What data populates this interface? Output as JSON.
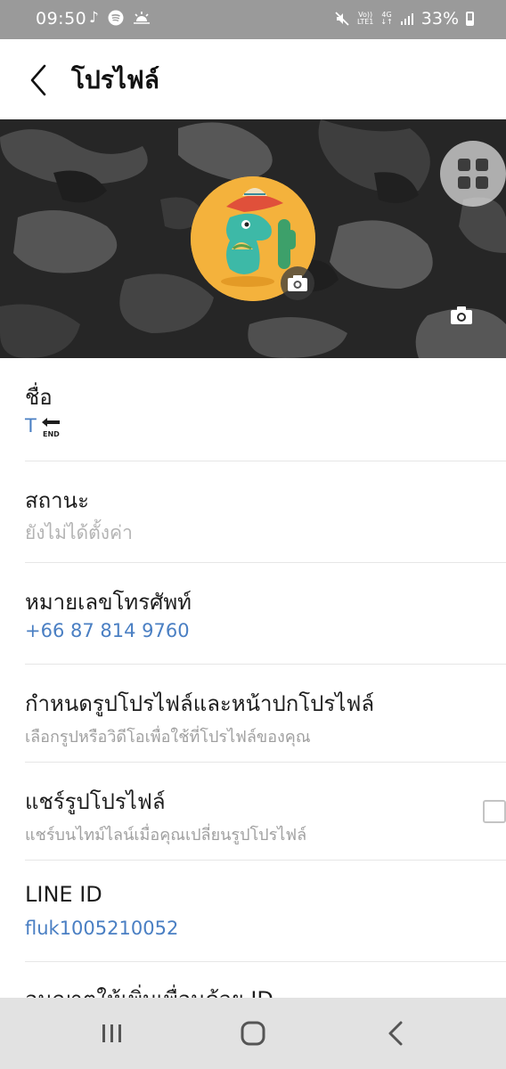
{
  "status_bar": {
    "time": "09:50",
    "left_icons": [
      "music-note-icon",
      "spotify-icon",
      "weather-sunrise-icon"
    ],
    "right_icons": [
      "mute-icon",
      "volte-icon",
      "4g-icon",
      "signal-icon"
    ],
    "volte_label_top": "Vo))",
    "volte_label_bottom": "LTE1",
    "net_label": "4G",
    "battery_percent": "33%"
  },
  "header": {
    "title": "โปรไฟล์"
  },
  "cover": {
    "colors": {
      "avatar_background": "#f4b23c",
      "dino": "#3db9a7"
    }
  },
  "rows": {
    "name": {
      "label": "ชื่อ",
      "value_text": "T",
      "value_icon_label": "END"
    },
    "status": {
      "label": "สถานะ",
      "placeholder": "ยังไม่ได้ตั้งค่า"
    },
    "phone": {
      "label": "หมายเลขโทรศัพท์",
      "value": "+66 87 814 9760"
    },
    "set_photo": {
      "label": "กำหนดรูปโปรไฟล์และหน้าปกโปรไฟล์",
      "description": "เลือกรูปหรือวิดีโอเพื่อใช้ที่โปรไฟล์ของคุณ"
    },
    "share_photo": {
      "label": "แชร์รูปโปรไฟล์",
      "description": "แชร์บนไทม์ไลน์เมื่อคุณเปลี่ยนรูปโปรไฟล์",
      "checked": false
    },
    "line_id": {
      "label": "LINE ID",
      "value": "fluk1005210052"
    },
    "allow_add_by_id": {
      "label": "อนุญาตให้เพิ่มเพื่อนด้วย ID"
    }
  },
  "nav": {
    "recents": "recents-icon",
    "home": "home-icon",
    "back": "back-icon"
  },
  "colors": {
    "status_bar": "#9a9a9a",
    "link_blue": "#4a7fc3",
    "secondary_gray": "#a0a0a0",
    "nav_bar": "#e2e2e2"
  }
}
